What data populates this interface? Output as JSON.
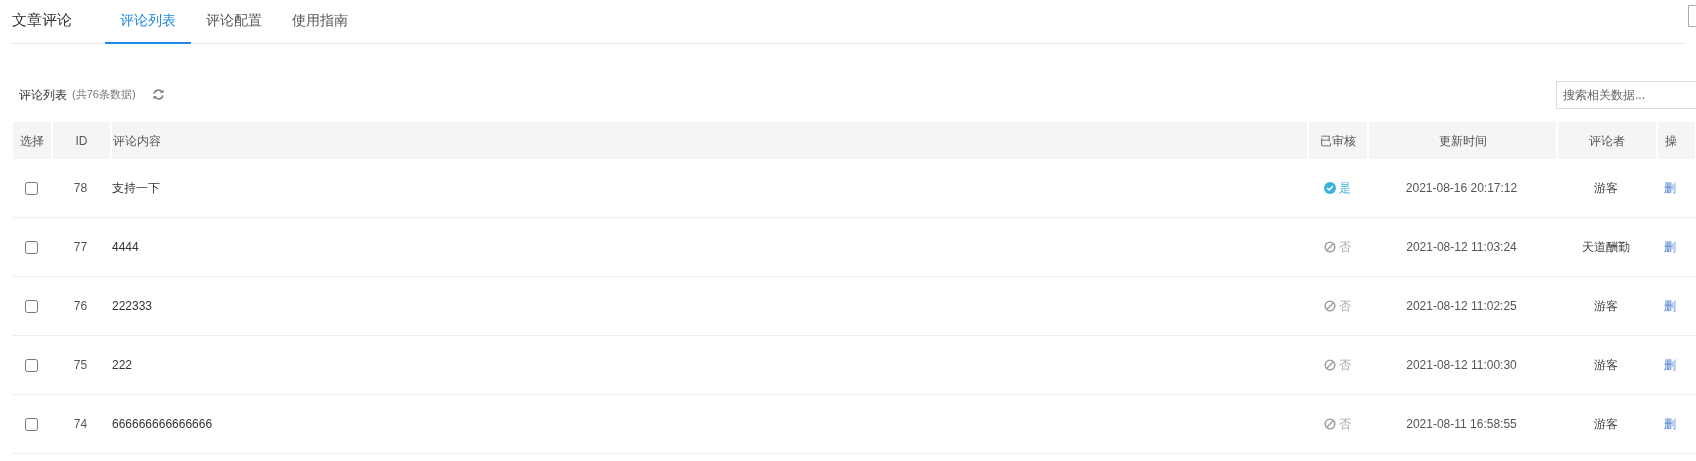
{
  "header": {
    "title": "文章评论",
    "tabs": [
      {
        "label": "评论列表",
        "selected": true
      },
      {
        "label": "评论配置",
        "selected": false
      },
      {
        "label": "使用指南",
        "selected": false
      }
    ]
  },
  "list": {
    "title": "评论列表",
    "count": "(共76条数据)",
    "search": {
      "placeholder": "搜索相关数据..."
    }
  },
  "table": {
    "columns": [
      "选择",
      "ID",
      "评论内容",
      "已审核",
      "更新时间",
      "评论者",
      "操"
    ],
    "rows": [
      {
        "selected": false,
        "id": "78",
        "content": "支持一下",
        "approved": true,
        "approved_label": "是",
        "time": "2021-08-16 20:17:12",
        "author": "游客",
        "action": "删"
      },
      {
        "selected": false,
        "id": "77",
        "content": "4444",
        "approved": false,
        "approved_label": "否",
        "time": "2021-08-12 11:03:24",
        "author": "天道酬勤",
        "action": "删"
      },
      {
        "selected": false,
        "id": "76",
        "content": "222333",
        "approved": false,
        "approved_label": "否",
        "time": "2021-08-12 11:02:25",
        "author": "游客",
        "action": "删"
      },
      {
        "selected": false,
        "id": "75",
        "content": "222",
        "approved": false,
        "approved_label": "否",
        "time": "2021-08-12 11:00:30",
        "author": "游客",
        "action": "删"
      },
      {
        "selected": false,
        "id": "74",
        "content": "666666666666666",
        "approved": false,
        "approved_label": "否",
        "time": "2021-08-11 16:58:55",
        "author": "游客",
        "action": "删"
      }
    ]
  }
}
